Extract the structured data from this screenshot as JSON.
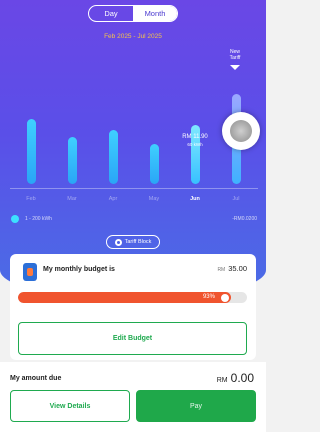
{
  "toggle": {
    "day_label": "Day",
    "month_label": "Month",
    "selected": "Month"
  },
  "period_label": "Feb 2025 - Jul 2025",
  "new_tariff": {
    "line1": "New",
    "line2": "Tariff"
  },
  "chart_data": {
    "type": "bar",
    "categories": [
      "Feb",
      "Mar",
      "Apr",
      "May",
      "Jun",
      "Jul"
    ],
    "values": [
      0.72,
      0.52,
      0.6,
      0.44,
      0.66,
      1.0
    ],
    "selected_category": "Jun",
    "selected_value": {
      "amount": "RM 11.90",
      "usage": "60 kWh"
    },
    "projected_category": "Jul",
    "grid": false
  },
  "legend": {
    "label": "1 - 200 kWh",
    "rate": "-RM0.0200",
    "color": "#3ce0ff"
  },
  "tariff_block_label": "Tariff Block",
  "budget": {
    "label": "My monthly budget is",
    "currency": "RM",
    "amount": "35.00",
    "percent_text": "93%",
    "percent": 93
  },
  "edit_budget_label": "Edit Budget",
  "amount_due": {
    "label": "My amount due",
    "currency": "RM",
    "amount": "0.00"
  },
  "view_details_label": "View Details",
  "pay_label": "Pay",
  "colors": {
    "accent_green": "#1fa84a",
    "progress_red": "#f0542e",
    "hero_purple": "#5a4fe8"
  }
}
